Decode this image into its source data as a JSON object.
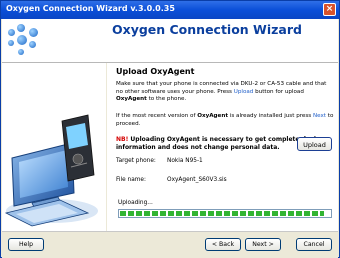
{
  "window": {
    "title": "Oxygen Connection Wizard v.3.0.0.35",
    "close_glyph": "×"
  },
  "header": {
    "title": "Oxygen Connection Wizard"
  },
  "content": {
    "section_title": "Upload OxyAgent",
    "para1_a": "Make sure that your phone is connected via DKU-2 or CA-53 cable and that no other software uses your phone. Press ",
    "para1_link": "Upload",
    "para1_b": " button for upload ",
    "para1_bold": "OxyAgent",
    "para1_c": " to the phone.",
    "para2_a": "If the most recent version of ",
    "para2_bold": "OxyAgent",
    "para2_b": " is already installed just press ",
    "para2_link": "Next",
    "para2_c": " to proceed.",
    "warning_prefix": "NB!",
    "warning_text": " Uploading OxyAgent is necessary to get complete device information and does not change personal data.",
    "upload_button": "Upload",
    "target_phone_label": "Target phone:",
    "target_phone_value": "Nokia N95-1",
    "file_name_label": "File name:",
    "file_name_value": "OxyAgent_S60V3.sis",
    "progress_label": "Uploading...",
    "progress_fraction": 0.97
  },
  "footer": {
    "help": "Help",
    "back": "< Back",
    "next": "Next >",
    "cancel": "Cancel"
  },
  "colors": {
    "title_blue": "#0b3f9e",
    "link": "#1f5ec9",
    "warning": "#d40000",
    "progress": "#32b432"
  }
}
